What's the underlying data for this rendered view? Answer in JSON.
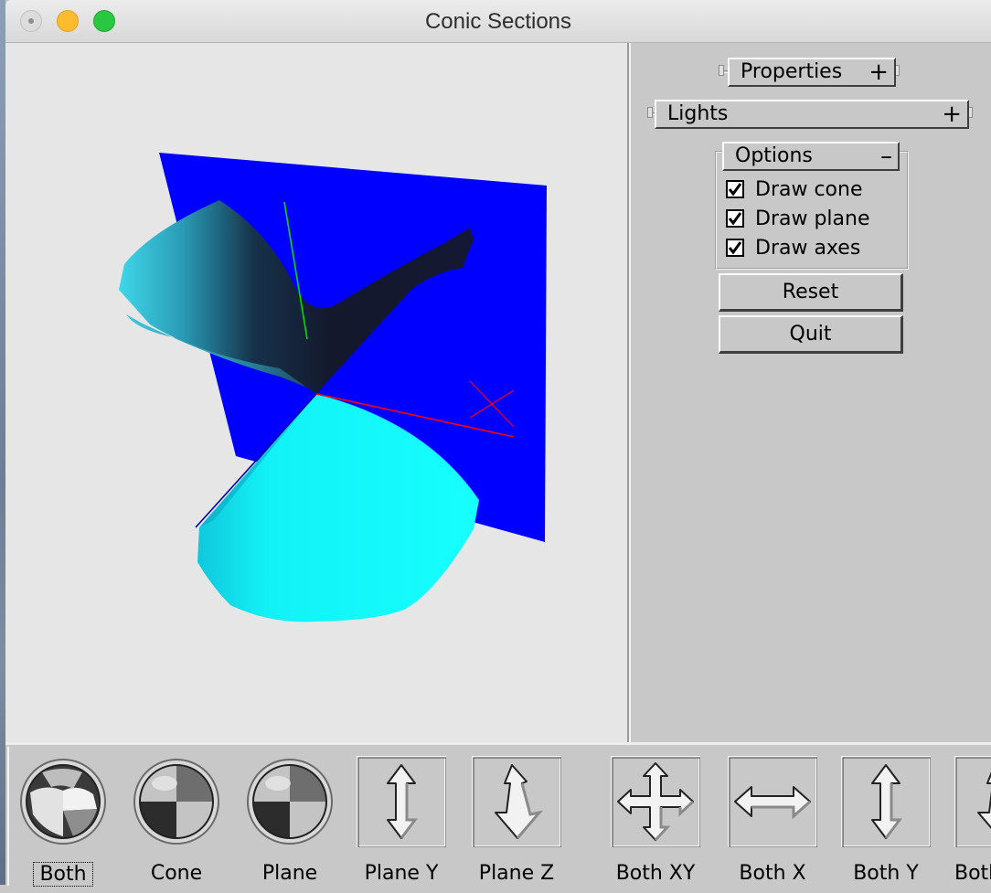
{
  "window": {
    "title": "Conic Sections"
  },
  "panel": {
    "properties_rollout": {
      "label": "Properties",
      "toggle": "+"
    },
    "lights_rollout": {
      "label": "Lights",
      "toggle": "+"
    },
    "options_rollout": {
      "label": "Options",
      "toggle": "–",
      "checkboxes": [
        {
          "label": "Draw cone",
          "checked": true
        },
        {
          "label": "Draw plane",
          "checked": true
        },
        {
          "label": "Draw axes",
          "checked": true
        }
      ]
    },
    "reset_label": "Reset",
    "quit_label": "Quit"
  },
  "toolbar": {
    "tools": [
      {
        "label": "Both",
        "icon": "trackball-rotate-icon",
        "focused": true
      },
      {
        "label": "Cone",
        "icon": "trackball-rotate-icon"
      },
      {
        "label": "Plane",
        "icon": "trackball-rotate-icon"
      },
      {
        "label": "Plane Y",
        "icon": "vertical-arrow-icon"
      },
      {
        "label": "Plane Z",
        "icon": "z-arrow-icon"
      },
      {
        "label": "Both XY",
        "icon": "four-way-arrow-icon"
      },
      {
        "label": "Both X",
        "icon": "horizontal-arrow-icon"
      },
      {
        "label": "Both Y",
        "icon": "vertical-arrow-icon"
      },
      {
        "label": "Both Z",
        "icon": "z-arrow-icon"
      }
    ]
  },
  "scene": {
    "plane_color": "#0000ff",
    "cone_color": "#11ffff",
    "axis_colors": {
      "x": "#ff0000",
      "y": "#00cc00",
      "z": "#0000aa"
    }
  }
}
